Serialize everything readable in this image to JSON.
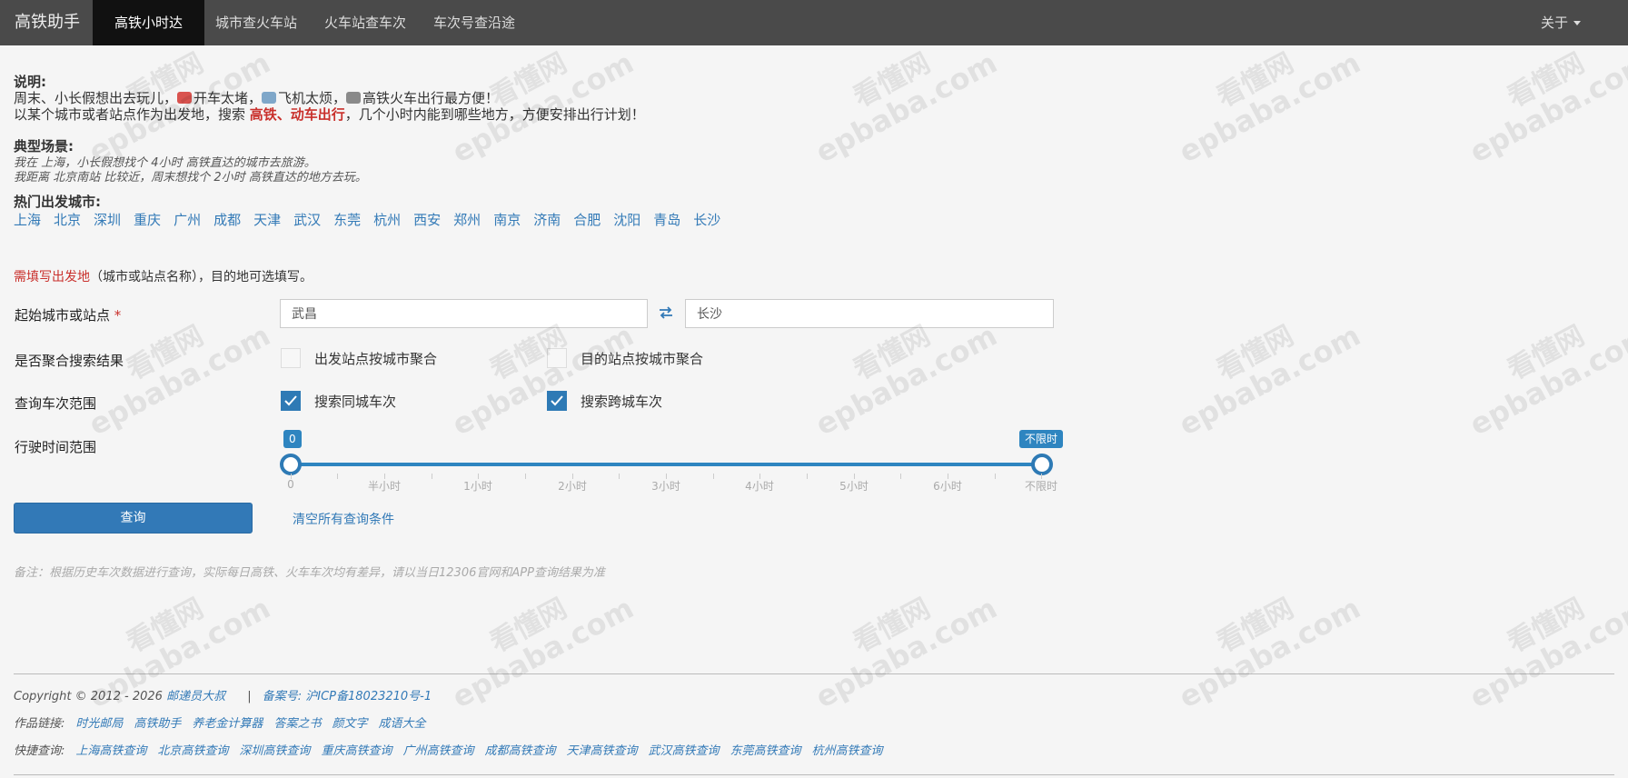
{
  "nav": {
    "brand": "高铁助手",
    "items": [
      "高铁小时达",
      "城市查火车站",
      "火车站查车次",
      "车次号查沿途"
    ],
    "about": "关于"
  },
  "intro": {
    "title": "说明:",
    "line1_a": "周末、小长假想出去玩儿，",
    "line1_b": "开车太堵，",
    "line1_c": "飞机太烦，",
    "line1_d": "高铁火车出行最方便！",
    "line2_a": "以某个城市或者站点作为出发地，搜索 ",
    "line2_b": "高铁、动车出行",
    "line2_c": "，几个小时内能到哪些地方，方便安排出行计划！"
  },
  "scenario": {
    "title": "典型场景:",
    "line1": "我在 上海，小长假想找个 4小时 高铁直达的城市去旅游。",
    "line2": "我距离 北京南站 比较近，周末想找个 2小时 高铁直达的地方去玩。"
  },
  "hot": {
    "title": "热门出发城市:",
    "cities": [
      "上海",
      "北京",
      "深圳",
      "重庆",
      "广州",
      "成都",
      "天津",
      "武汉",
      "东莞",
      "杭州",
      "西安",
      "郑州",
      "南京",
      "济南",
      "合肥",
      "沈阳",
      "青岛",
      "长沙"
    ]
  },
  "form": {
    "required_a": "需填写出发地",
    "required_b": "（城市或站点名称），目的地可选填写。",
    "label_origin": "起始城市或站点",
    "star": "*",
    "origin_value": "武昌",
    "dest_value": "长沙",
    "label_aggregate": "是否聚合搜索结果",
    "agg_from": "出发站点按城市聚合",
    "agg_to": "目的站点按城市聚合",
    "label_range": "查询车次范围",
    "same_city": "搜索同城车次",
    "cross_city": "搜索跨城车次",
    "label_time": "行驶时间范围",
    "slider_min": "0",
    "slider_max": "不限时",
    "ticks": [
      "0",
      "半小时",
      "1小时",
      "2小时",
      "3小时",
      "4小时",
      "5小时",
      "6小时",
      "不限时"
    ],
    "query": "查询",
    "clear": "清空所有查询条件"
  },
  "note": "备注：根据历史车次数据进行查询，实际每日高铁、火车车次均有差异，请以当日12306官网和APP查询结果为准",
  "footer": {
    "copyright": "Copyright © 2012 - 2026",
    "author": "邮递员大叔",
    "sep": "|",
    "icp": "备案号: 沪ICP备18023210号-1",
    "works_label": "作品链接:",
    "works": [
      "时光邮局",
      "高铁助手",
      "养老金计算器",
      "答案之书",
      "颜文字",
      "成语大全"
    ],
    "quick_label": "快捷查询:",
    "quick": [
      "上海高铁查询",
      "北京高铁查询",
      "深圳高铁查询",
      "重庆高铁查询",
      "广州高铁查询",
      "成都高铁查询",
      "天津高铁查询",
      "武汉高铁查询",
      "东莞高铁查询",
      "杭州高铁查询"
    ]
  },
  "watermark": {
    "line1": "看懂网",
    "line2": "epbaba.com"
  },
  "colors": {
    "accent": "#337ab7",
    "required": "#c9302c",
    "navbar": "#4a4a4a"
  }
}
